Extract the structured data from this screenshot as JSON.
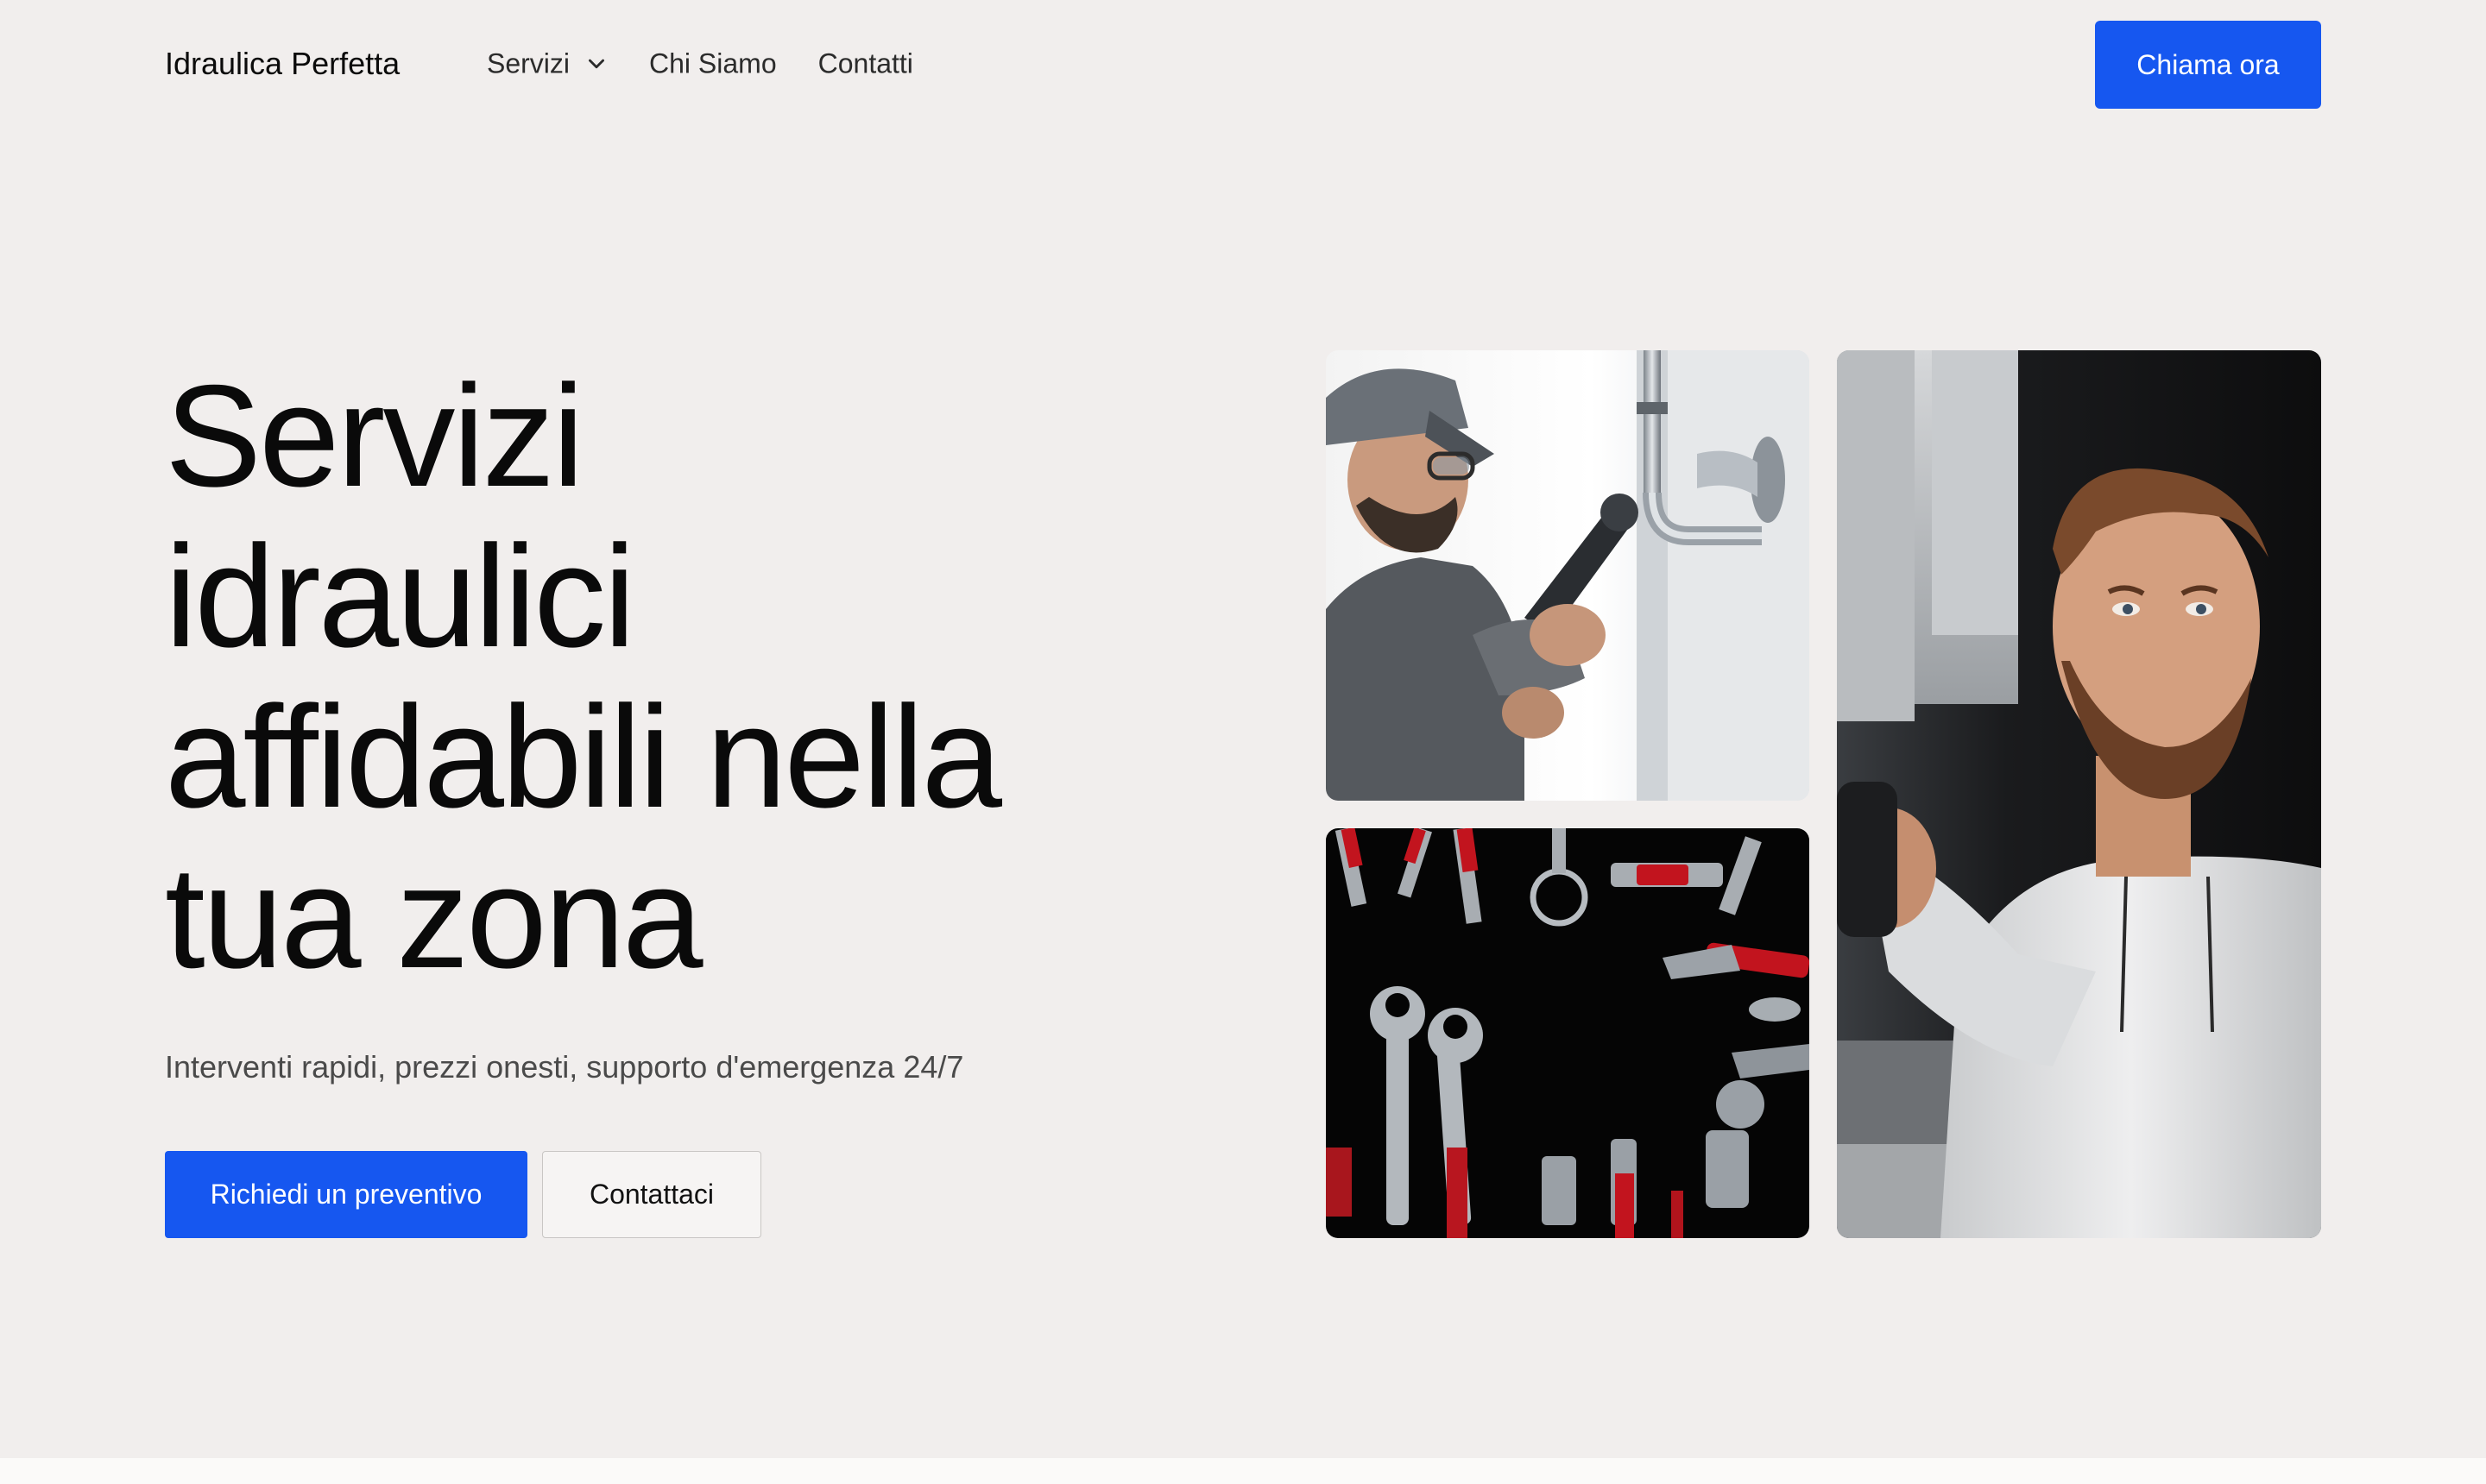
{
  "nav": {
    "brand": "Idraulica Perfetta",
    "links": [
      {
        "label": "Servizi",
        "has_dropdown": true,
        "icon": "chevron-down-icon"
      },
      {
        "label": "Chi Siamo"
      },
      {
        "label": "Contatti"
      }
    ],
    "cta_label": "Chiama ora"
  },
  "hero": {
    "title_lines": [
      "Servizi",
      "idraulici",
      "affidabili nella",
      "tua zona"
    ],
    "subtitle": "Interventi rapidi, prezzi onesti, supporto d'emergenza 24/7",
    "primary_button": "Richiedi un preventivo",
    "secondary_button": "Contattaci"
  },
  "images": [
    {
      "name": "plumber-fixing-pipe-photo"
    },
    {
      "name": "plumbing-tools-photo"
    },
    {
      "name": "plumber-portrait-photo"
    }
  ],
  "colors": {
    "background": "#f1eeed",
    "accent": "#1657f0",
    "text": "#0a0a0a"
  }
}
